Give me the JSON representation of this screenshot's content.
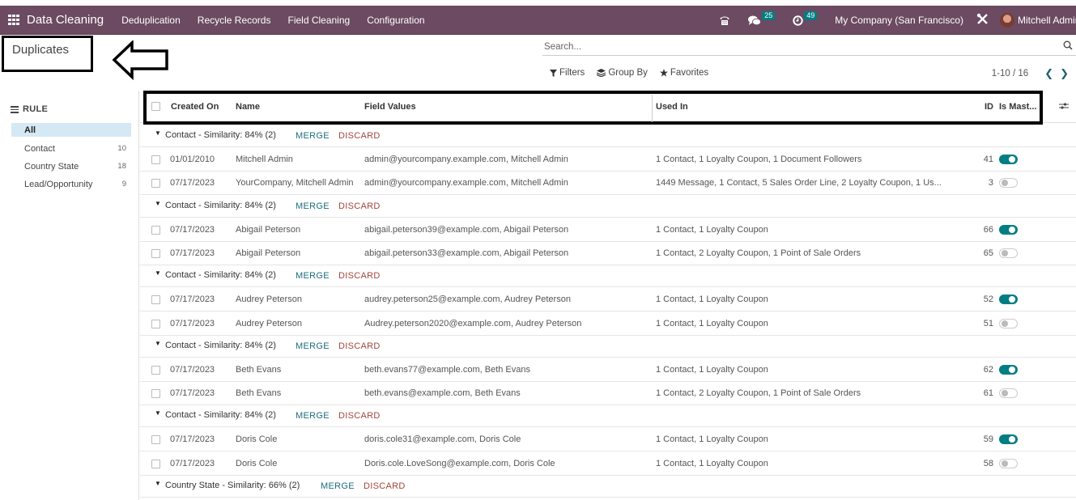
{
  "navbar": {
    "app_name": "Data Cleaning",
    "menu": [
      "Deduplication",
      "Recycle Records",
      "Field Cleaning",
      "Configuration"
    ],
    "messages_count": "25",
    "activities_count": "49",
    "company": "My Company (San Francisco)",
    "user": "Mitchell Admin",
    "icons": [
      "apps-grid-icon",
      "phone-icon",
      "chat-icon",
      "clock-icon",
      "tools-icon"
    ]
  },
  "page": {
    "title": "Duplicates"
  },
  "search": {
    "placeholder": "Search...",
    "value": ""
  },
  "filters": {
    "filters_label": "Filters",
    "group_by_label": "Group By",
    "favorites_label": "Favorites"
  },
  "pager": {
    "value": "1-10 / 16"
  },
  "sidebar": {
    "heading": "RULE",
    "items": [
      {
        "label": "All",
        "count": "",
        "active": true
      },
      {
        "label": "Contact",
        "count": "10"
      },
      {
        "label": "Country State",
        "count": "18"
      },
      {
        "label": "Lead/Opportunity",
        "count": "9"
      }
    ]
  },
  "table": {
    "columns": [
      "Created On",
      "Name",
      "Field Values",
      "Used In",
      "ID",
      "Is Mast..."
    ],
    "merge_label": "MERGE",
    "discard_label": "DISCARD",
    "groups": [
      {
        "title": "Contact - Similarity: 84% (2)",
        "rows": [
          {
            "created_on": "01/01/2010",
            "name": "Mitchell Admin",
            "field_values": "admin@yourcompany.example.com, Mitchell Admin",
            "used_in": "1 Contact, 1 Loyalty Coupon, 1 Document Followers",
            "id": "41",
            "is_master": true
          },
          {
            "created_on": "07/17/2023",
            "name": "YourCompany, Mitchell Admin",
            "field_values": "admin@yourcompany.example.com, Mitchell Admin",
            "used_in": "1449 Message, 1 Contact, 5 Sales Order Line, 2 Loyalty Coupon, 1 Us...",
            "id": "3",
            "is_master": false
          }
        ]
      },
      {
        "title": "Contact - Similarity: 84% (2)",
        "rows": [
          {
            "created_on": "07/17/2023",
            "name": "Abigail Peterson",
            "field_values": "abigail.peterson39@example.com, Abigail Peterson",
            "used_in": "1 Contact, 1 Loyalty Coupon",
            "id": "66",
            "is_master": true
          },
          {
            "created_on": "07/17/2023",
            "name": "Abigail Peterson",
            "field_values": "abigail.peterson33@example.com, Abigail Peterson",
            "used_in": "1 Contact, 2 Loyalty Coupon, 1 Point of Sale Orders",
            "id": "65",
            "is_master": false
          }
        ]
      },
      {
        "title": "Contact - Similarity: 84% (2)",
        "rows": [
          {
            "created_on": "07/17/2023",
            "name": "Audrey Peterson",
            "field_values": "audrey.peterson25@example.com, Audrey Peterson",
            "used_in": "1 Contact, 1 Loyalty Coupon",
            "id": "52",
            "is_master": true
          },
          {
            "created_on": "07/17/2023",
            "name": "Audrey Peterson",
            "field_values": "Audrey.peterson2020@example.com, Audrey Peterson",
            "used_in": "1 Contact, 1 Loyalty Coupon",
            "id": "51",
            "is_master": false
          }
        ]
      },
      {
        "title": "Contact - Similarity: 84% (2)",
        "rows": [
          {
            "created_on": "07/17/2023",
            "name": "Beth Evans",
            "field_values": "beth.evans77@example.com, Beth Evans",
            "used_in": "1 Contact, 1 Loyalty Coupon",
            "id": "62",
            "is_master": true
          },
          {
            "created_on": "07/17/2023",
            "name": "Beth Evans",
            "field_values": "beth.evans@example.com, Beth Evans",
            "used_in": "1 Contact, 2 Loyalty Coupon, 1 Point of Sale Orders",
            "id": "61",
            "is_master": false
          }
        ]
      },
      {
        "title": "Contact - Similarity: 84% (2)",
        "rows": [
          {
            "created_on": "07/17/2023",
            "name": "Doris Cole",
            "field_values": "doris.cole31@example.com, Doris Cole",
            "used_in": "1 Contact, 1 Loyalty Coupon",
            "id": "59",
            "is_master": true
          },
          {
            "created_on": "07/17/2023",
            "name": "Doris Cole",
            "field_values": "Doris.cole.LoveSong@example.com, Doris Cole",
            "used_in": "1 Contact, 1 Loyalty Coupon",
            "id": "58",
            "is_master": false
          }
        ]
      },
      {
        "title": "Country State - Similarity: 66% (2)",
        "rows": []
      }
    ]
  },
  "colors": {
    "navbar": "#6b4a62",
    "badge": "#017e84",
    "toggle_on": "#017e84",
    "merge": "#1b6d7c",
    "discard": "#a3463c",
    "sidebar_active": "#d4e9f4"
  }
}
